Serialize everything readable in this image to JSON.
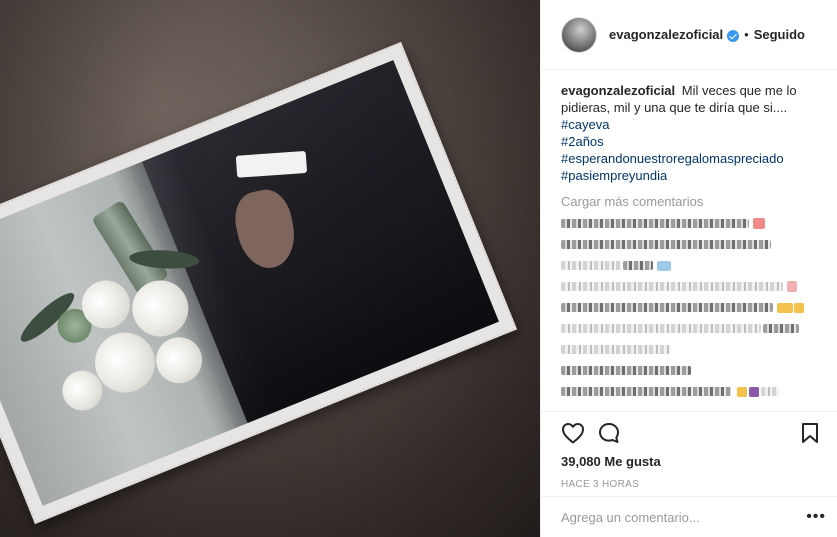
{
  "header": {
    "username": "evagonzalezoficial",
    "verified_icon": "verified-badge-icon",
    "separator": "•",
    "follow_state": "Seguido"
  },
  "caption": {
    "username": "evagonzalezoficial",
    "text": "Mil veces que me lo pidieras, mil y una que te diría que si....",
    "hashtags": [
      "#cayeva",
      "#2años",
      "#esperandonuestroregalomaspreciado",
      "#pasiempreyundia"
    ]
  },
  "load_more": "Cargar más comentarios",
  "actions": {
    "like_icon": "heart-icon",
    "comment_icon": "comment-bubble-icon",
    "save_icon": "bookmark-icon",
    "likes": "39,080 Me gusta",
    "timestamp": "HACE 3 HORAS"
  },
  "add_comment": {
    "placeholder": "Agrega un comentario...",
    "more_icon": "more-options-icon",
    "more_label": "•••"
  },
  "colors": {
    "link": "#003569",
    "muted": "#999999",
    "verified": "#3897f0",
    "text": "#262626"
  }
}
